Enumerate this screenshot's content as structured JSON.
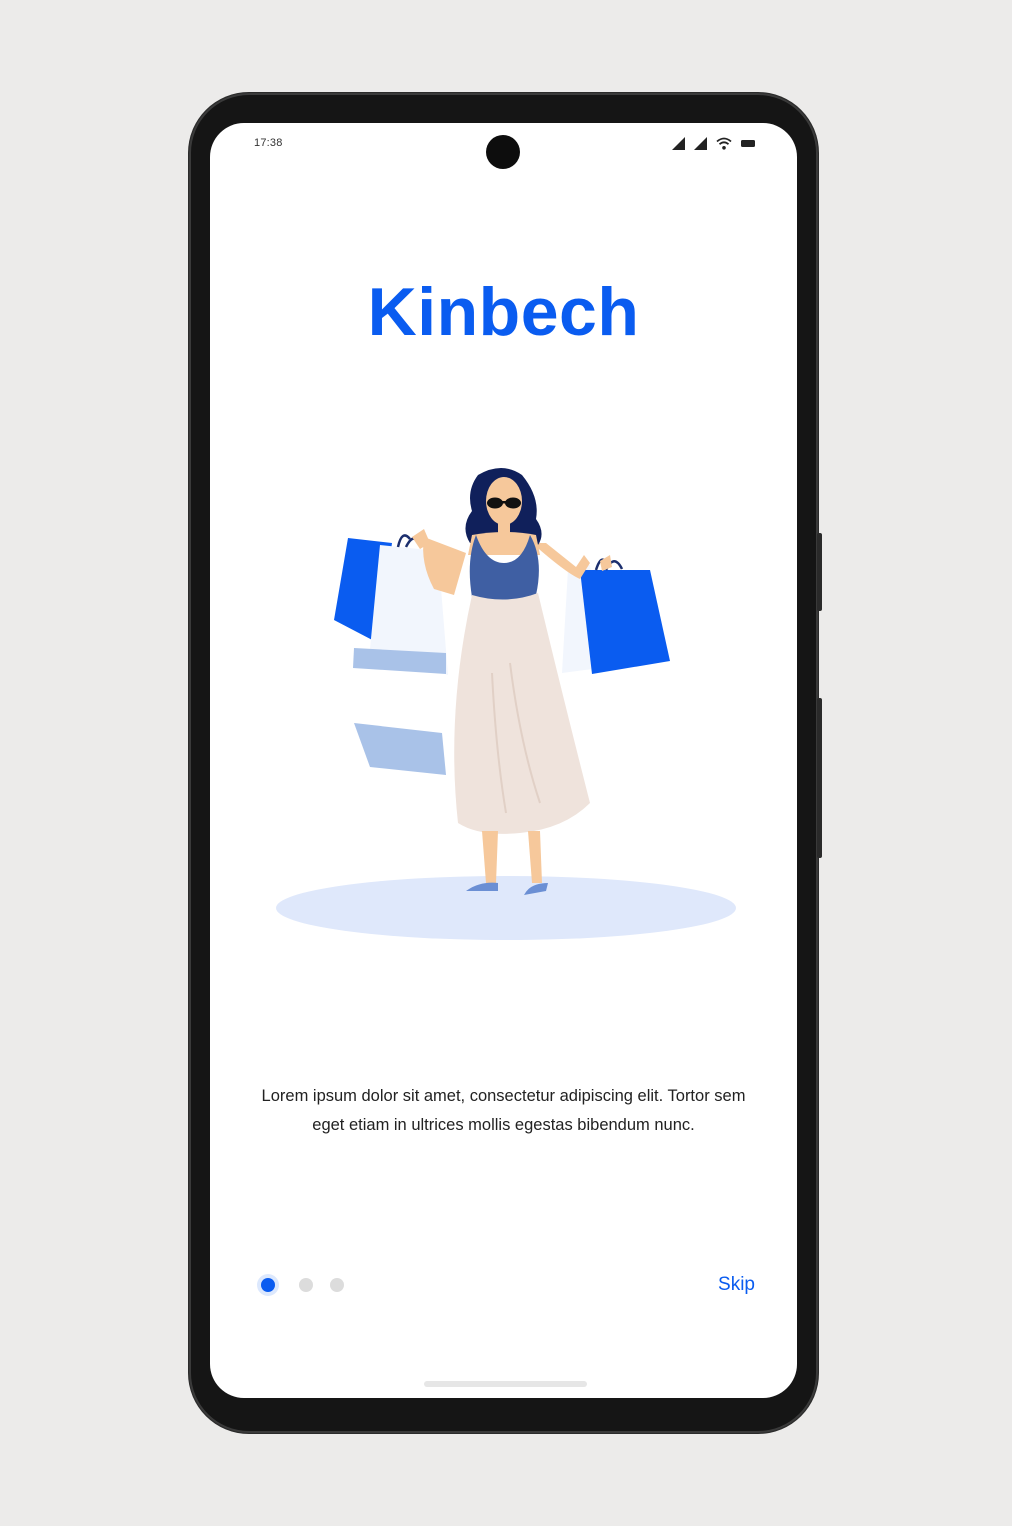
{
  "status_bar": {
    "time": "17:38",
    "icons": [
      "signal-icon",
      "signal-icon",
      "wifi-icon",
      "battery-icon"
    ]
  },
  "app": {
    "title": "Kinbech",
    "brand_color": "#0a5cf0"
  },
  "onboarding": {
    "description": "Lorem ipsum dolor sit amet, consectetur adipiscing elit. Tortor sem eget etiam in ultrices mollis egestas bibendum nunc.",
    "page_count": 3,
    "active_page": 1,
    "skip_label": "Skip"
  },
  "illustration": {
    "icon": "woman-with-shopping-bags-illustration"
  }
}
